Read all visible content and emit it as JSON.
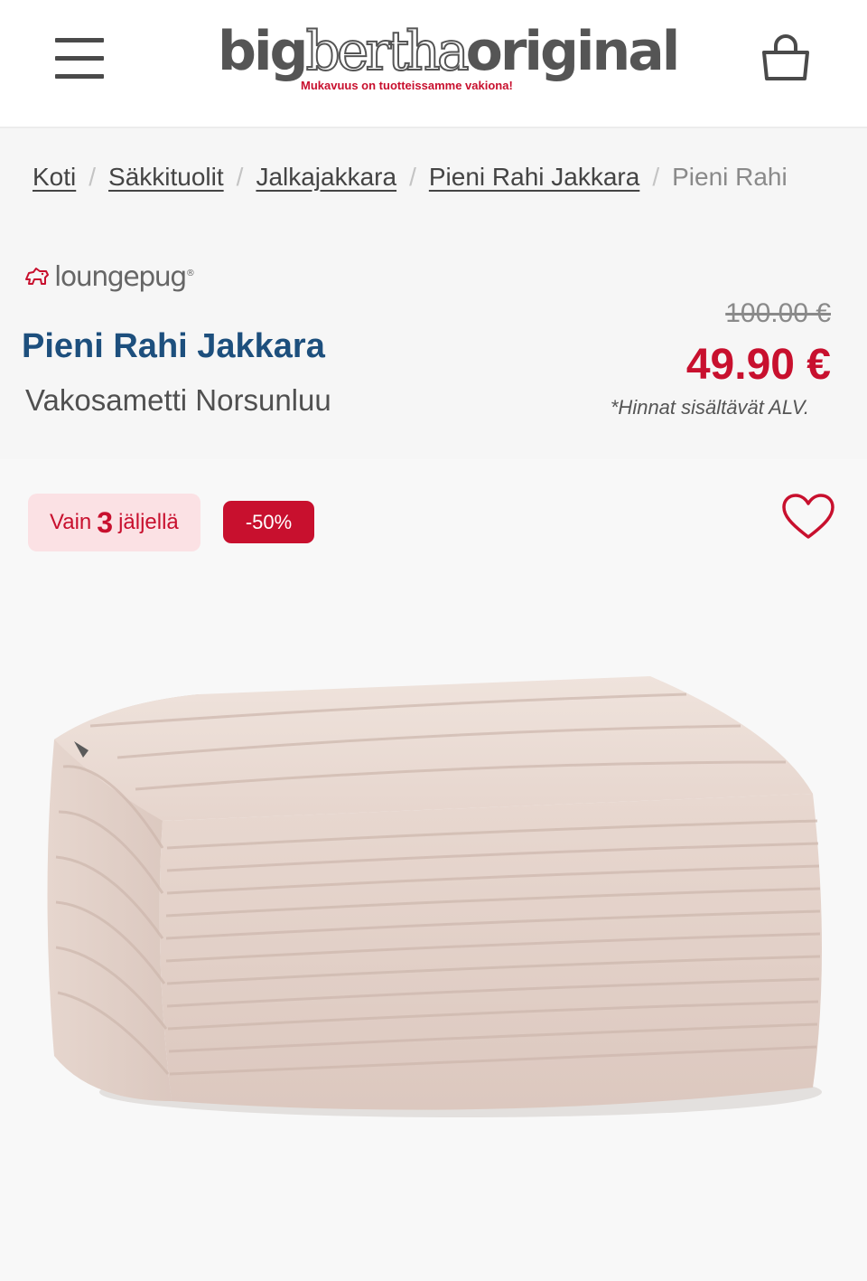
{
  "header": {
    "logo": {
      "bold_start": "big",
      "outline_mid": "bertha",
      "bold_end": "original",
      "tagline": "Mukavuus on tuotteissamme vakiona!"
    },
    "menu_icon": "hamburger-icon",
    "cart_icon": "shopping-bag-icon"
  },
  "breadcrumb": {
    "items": [
      "Koti",
      "Säkkituolit",
      "Jalkajakkara",
      "Pieni Rahi Jakkara"
    ],
    "current": "Pieni Rahi",
    "separator": "/"
  },
  "product": {
    "brand": "loungepug",
    "brand_mark": "®",
    "title": "Pieni Rahi Jakkara",
    "variant": "Vakosametti Norsunluu",
    "old_price": "100.00 €",
    "price": "49.90 €",
    "vat_note": "*Hinnat sisältävät ALV."
  },
  "badges": {
    "stock_prefix": "Vain",
    "stock_count": "3",
    "stock_suffix": "jäljellä",
    "discount": "-50%"
  },
  "colors": {
    "accent_red": "#c8102e",
    "title_blue": "#1d4f7d",
    "stock_bg": "#fbe1e4",
    "product_cream": "#ead9d1"
  },
  "icons": {
    "wishlist": "heart-icon",
    "brand": "pug-icon"
  }
}
